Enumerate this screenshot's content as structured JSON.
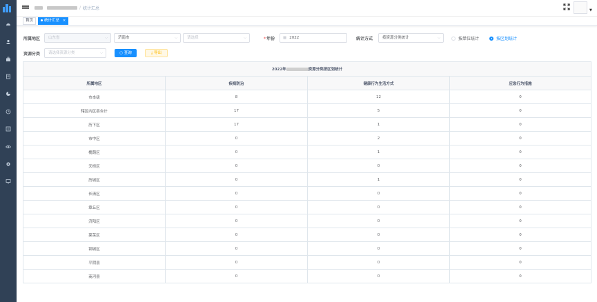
{
  "sidebar": {
    "icons": [
      "dashboard-icon",
      "user-icon",
      "briefcase-icon",
      "document-icon",
      "chart-icon",
      "clock-icon",
      "list-icon",
      "eye-icon",
      "gear-icon",
      "monitor-icon"
    ]
  },
  "header": {
    "breadcrumb_current": "统计汇总",
    "breadcrumb_sep": "/"
  },
  "tags": {
    "home": "首页",
    "active": "统计汇总",
    "close": "×"
  },
  "filters": {
    "region_label": "所属地区",
    "province_value": "山东省",
    "city_value": "济南市",
    "district_placeholder": "请选择",
    "year_label": "年份",
    "year_required_mark": "*",
    "year_value": "2022",
    "method_label": "统计方式",
    "method_value": "按资源分类统计",
    "radio_unit": "按单位统计",
    "radio_district": "按区划统计",
    "category_label": "资源分类",
    "category_placeholder": "请选择资源分类",
    "search_button": "查询",
    "export_button": "导出"
  },
  "table": {
    "title_prefix": "2022年",
    "title_suffix": "资源分类按区划统计",
    "headers": [
      "所属地区",
      "疾病防治",
      "健康行为生活方式",
      "应急行为措施"
    ],
    "rows": [
      [
        "市本级",
        "8",
        "12",
        "0"
      ],
      [
        "辖区内区县合计",
        "17",
        "5",
        "0"
      ],
      [
        "历下区",
        "17",
        "1",
        "0"
      ],
      [
        "市中区",
        "0",
        "2",
        "0"
      ],
      [
        "槐荫区",
        "0",
        "1",
        "0"
      ],
      [
        "天桥区",
        "0",
        "0",
        "0"
      ],
      [
        "历城区",
        "0",
        "1",
        "0"
      ],
      [
        "长清区",
        "0",
        "0",
        "0"
      ],
      [
        "章丘区",
        "0",
        "0",
        "0"
      ],
      [
        "济阳区",
        "0",
        "0",
        "0"
      ],
      [
        "莱芜区",
        "0",
        "0",
        "0"
      ],
      [
        "钢城区",
        "0",
        "0",
        "0"
      ],
      [
        "平阴县",
        "0",
        "0",
        "0"
      ],
      [
        "商河县",
        "0",
        "0",
        "0"
      ]
    ]
  },
  "colors": {
    "sidebar": "#304156",
    "primary": "#1890ff",
    "warning": "#ffba00"
  }
}
